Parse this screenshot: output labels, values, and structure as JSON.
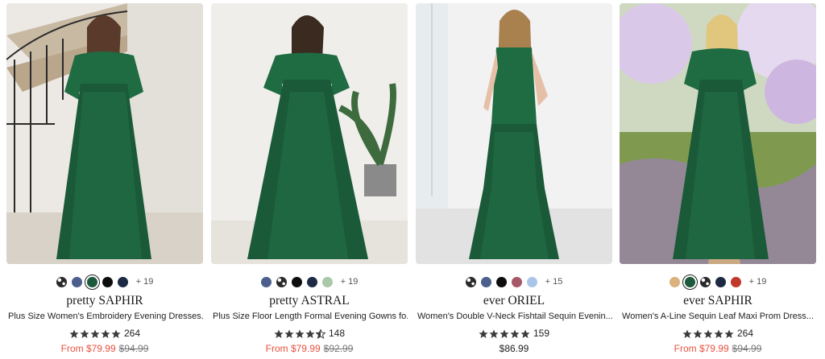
{
  "colors": {
    "sale": "#e8523f",
    "star": "#3b3b3b"
  },
  "products": [
    {
      "brand": "pretty SAPHIR",
      "title": "Plus Size Women's Embroidery Evening Dresses...",
      "rating": 5,
      "reviews": "264",
      "price_from": "From $79.99",
      "price_orig": "$94.99",
      "swatches": [
        {
          "color": "pattern",
          "name": "print"
        },
        {
          "color": "#4b5e8c",
          "name": "navy-blue"
        },
        {
          "color": "#1c5a3b",
          "name": "dark-green",
          "selected": true
        },
        {
          "color": "#0d0d0d",
          "name": "black"
        },
        {
          "color": "#1e2a44",
          "name": "dark-navy"
        }
      ],
      "more": "+ 19"
    },
    {
      "brand": "pretty ASTRAL",
      "title": "Plus Size Floor Length Formal Evening Gowns fo...",
      "rating": 4.5,
      "reviews": "148",
      "price_from": "From $79.99",
      "price_orig": "$92.99",
      "swatches": [
        {
          "color": "#4b5e8c",
          "name": "navy-blue"
        },
        {
          "color": "pattern",
          "name": "print"
        },
        {
          "color": "#0d0d0d",
          "name": "black"
        },
        {
          "color": "#1e2a44",
          "name": "dark-navy"
        },
        {
          "color": "#a9c9a8",
          "name": "sage"
        }
      ],
      "more": "+ 19"
    },
    {
      "brand": "ever ORIEL",
      "title": "Women's Double V-Neck Fishtail Sequin Evenin...",
      "rating": 5,
      "reviews": "159",
      "price": "$86.99",
      "swatches": [
        {
          "color": "pattern",
          "name": "print"
        },
        {
          "color": "#4b5e8c",
          "name": "navy-blue"
        },
        {
          "color": "#0d0d0d",
          "name": "black"
        },
        {
          "color": "#a65868",
          "name": "mauve"
        },
        {
          "color": "#a9c6ea",
          "name": "light-blue"
        }
      ],
      "more": "+ 15"
    },
    {
      "brand": "ever SAPHIR",
      "title": "Women's A-Line Sequin Leaf Maxi Prom Dress...",
      "rating": 5,
      "reviews": "264",
      "price_from": "From $79.99",
      "price_orig": "$94.99",
      "swatches": [
        {
          "color": "#d9b27e",
          "name": "champagne"
        },
        {
          "color": "#1c5a3b",
          "name": "dark-green",
          "selected": true
        },
        {
          "color": "pattern",
          "name": "print"
        },
        {
          "color": "#1e2a44",
          "name": "dark-navy"
        },
        {
          "color": "#c0392b",
          "name": "red"
        }
      ],
      "more": "+ 19"
    }
  ]
}
